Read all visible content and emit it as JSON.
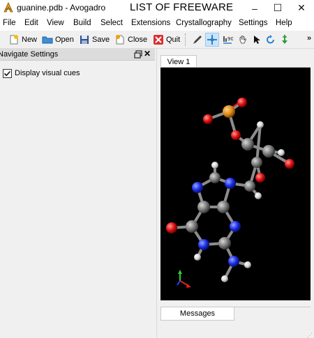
{
  "window": {
    "title": "guanine.pdb - Avogadro",
    "watermark": "LIST OF FREEWARE",
    "minimize_glyph": "–",
    "maximize_glyph": "☐",
    "close_glyph": "✕"
  },
  "menu": [
    "File",
    "Edit",
    "View",
    "Build",
    "Select",
    "Extensions",
    "Crystallography",
    "Settings",
    "Help"
  ],
  "toolbar": {
    "new_label": "New",
    "open_label": "Open",
    "save_label": "Save",
    "close_label": "Close",
    "quit_label": "Quit",
    "tools": [
      "draw-tool-icon",
      "navigate-tool-icon",
      "measure-tool-icon",
      "manipulate-tool-icon",
      "select-tool-icon",
      "rotate-tool-icon",
      "auto-optimize-tool-icon"
    ],
    "overflow_glyph": "»"
  },
  "dock": {
    "title": "Navigate Settings",
    "close_glyph": "✕",
    "display_visual_cues_label": "Display visual cues",
    "display_visual_cues_checked": true
  },
  "view": {
    "tab_label": "View 1",
    "messages_tab_label": "Messages"
  },
  "colors": {
    "carbon": "#8a8a8a",
    "nitrogen": "#1a2ee6",
    "oxygen": "#e01010",
    "phosphorus": "#e08a1a",
    "hydrogen": "#e6e6e6",
    "viewport_bg": "#000000"
  }
}
